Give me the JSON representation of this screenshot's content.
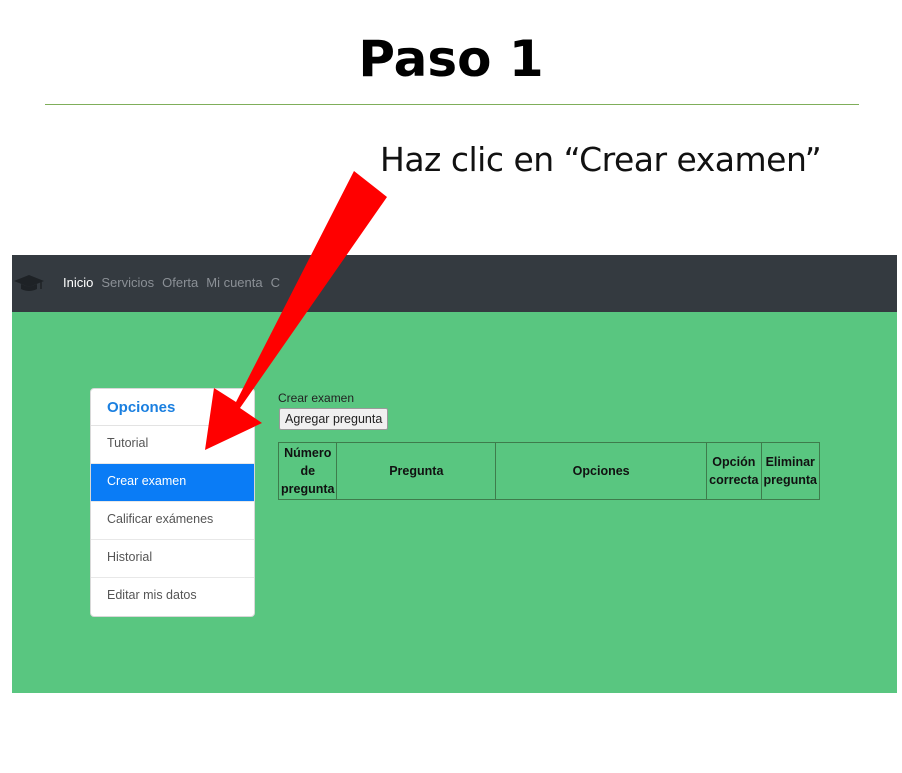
{
  "slide": {
    "title": "Paso 1",
    "instruction": "Haz clic en “Crear examen”"
  },
  "navbar": {
    "logo_icon": "graduation-cap-icon",
    "links": [
      "Inicio",
      "Servicios",
      "Oferta",
      "Mi cuenta",
      "C"
    ]
  },
  "sidebar": {
    "header": "Opciones",
    "items": [
      "Tutorial",
      "Crear examen",
      "Calificar exámenes",
      "Historial",
      "Editar mis datos"
    ],
    "active_index": 1
  },
  "main": {
    "section_label": "Crear examen",
    "add_button": "Agregar pregunta",
    "table_headers": [
      "Número de pregunta",
      "Pregunta",
      "Opciones",
      "Opción correcta",
      "Eliminar pregunta"
    ]
  },
  "colors": {
    "background": "#59c680",
    "navbar": "#343a40",
    "active_item": "#0a7cf6",
    "arrow": "#ff0000",
    "title_rule": "#7fae5a"
  }
}
